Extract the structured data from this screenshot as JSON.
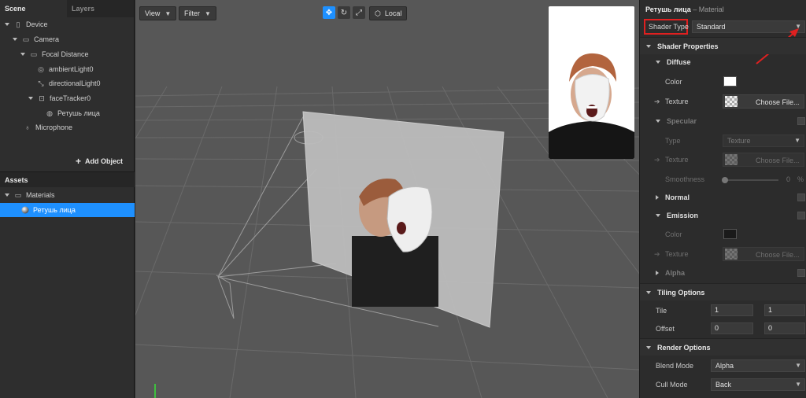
{
  "scene": {
    "tabs": [
      "Scene",
      "Layers"
    ],
    "tree": [
      "Device",
      "Camera",
      "Focal Distance",
      "ambientLight0",
      "directionalLight0",
      "faceTracker0",
      "Ретушь лица",
      "Microphone"
    ],
    "add_object": "Add Object"
  },
  "assets": {
    "title": "Assets",
    "folder": "Materials",
    "item": "Ретушь лица"
  },
  "viewport": {
    "view_label": "View",
    "filter_label": "Filter",
    "local_label": "Local"
  },
  "inspector": {
    "title_name": "Ретушь лица",
    "title_sep": " – ",
    "title_type": "Material",
    "shader_type_label": "Shader Type",
    "shader_type_value": "Standard",
    "shader_properties": "Shader Properties",
    "diffuse": {
      "title": "Diffuse",
      "color_label": "Color",
      "color_value": "#ffffff",
      "texture_label": "Texture",
      "choose": "Choose File..."
    },
    "specular": {
      "title": "Specular",
      "type_label": "Type",
      "type_value": "Texture",
      "texture_label": "Texture",
      "choose": "Choose File...",
      "smoothness_label": "Smoothness",
      "smoothness_value": "0",
      "smoothness_unit": "%"
    },
    "normal": "Normal",
    "emission": {
      "title": "Emission",
      "color_label": "Color",
      "color_value": "#1a1a1a",
      "texture_label": "Texture",
      "choose": "Choose File..."
    },
    "alpha": "Alpha",
    "tiling": {
      "title": "Tiling Options",
      "tile_label": "Tile",
      "tile_x": "1",
      "tile_y": "1",
      "offset_label": "Offset",
      "offset_x": "0",
      "offset_y": "0"
    },
    "render": {
      "title": "Render Options",
      "blend_label": "Blend Mode",
      "blend_value": "Alpha",
      "cull_label": "Cull Mode",
      "cull_value": "Back"
    }
  },
  "colors": {
    "accent": "#1e90ff",
    "highlight_box": "#e02020",
    "annotation_arrow": "#e02020"
  }
}
